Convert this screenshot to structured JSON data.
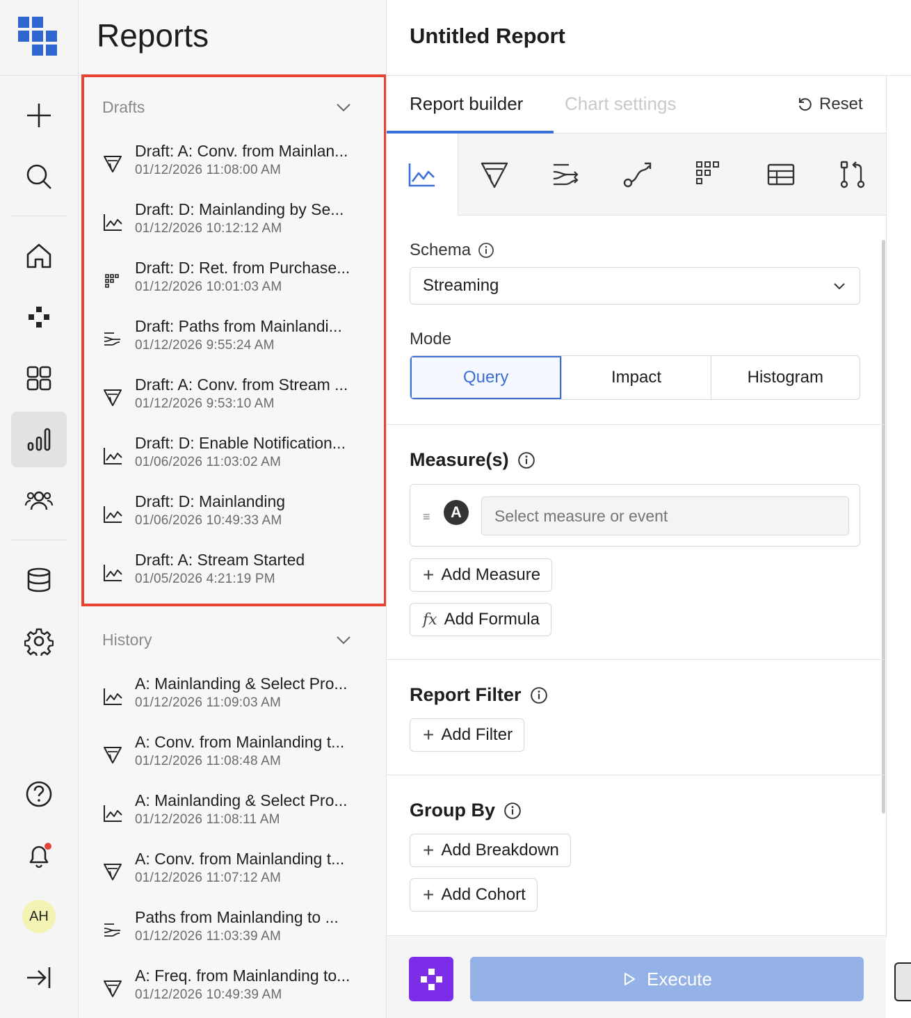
{
  "rail": {
    "logo_icon": "app-grid-logo",
    "items": [
      {
        "name": "add",
        "icon": "plus-icon"
      },
      {
        "name": "search",
        "icon": "search-icon"
      },
      {
        "name": "home",
        "icon": "home-icon"
      },
      {
        "name": "events",
        "icon": "nodes-icon"
      },
      {
        "name": "dashboards",
        "icon": "dashboard-icon"
      },
      {
        "name": "reports",
        "icon": "bar-chart-icon",
        "active": true
      },
      {
        "name": "cohorts",
        "icon": "users-icon"
      },
      {
        "name": "data",
        "icon": "database-icon"
      },
      {
        "name": "settings",
        "icon": "gear-icon"
      },
      {
        "name": "help",
        "icon": "help-icon"
      },
      {
        "name": "notifications",
        "icon": "bell-icon"
      },
      {
        "name": "collapse",
        "icon": "collapse-icon"
      }
    ],
    "avatar_initials": "AH",
    "notification_dot_color": "#e0453a"
  },
  "panel": {
    "title": "Reports",
    "drafts_label": "Drafts",
    "history_label": "History",
    "drafts": [
      {
        "icon": "funnel",
        "title": "Draft: A: Conv. from Mainlan...",
        "date": "01/12/2026 11:08:00 AM"
      },
      {
        "icon": "line",
        "title": "Draft: D: Mainlanding by Se...",
        "date": "01/12/2026 10:12:12 AM"
      },
      {
        "icon": "retention",
        "title": "Draft: D: Ret. from Purchase...",
        "date": "01/12/2026 10:01:03 AM"
      },
      {
        "icon": "paths",
        "title": "Draft: Paths from Mainlandi...",
        "date": "01/12/2026 9:55:24 AM"
      },
      {
        "icon": "funnel",
        "title": "Draft: A: Conv. from Stream ...",
        "date": "01/12/2026 9:53:10 AM"
      },
      {
        "icon": "line",
        "title": "Draft: D: Enable Notification...",
        "date": "01/06/2026 11:03:02 AM"
      },
      {
        "icon": "line",
        "title": "Draft: D: Mainlanding",
        "date": "01/06/2026 10:49:33 AM"
      },
      {
        "icon": "line",
        "title": "Draft: A: Stream Started",
        "date": "01/05/2026 4:21:19 PM"
      }
    ],
    "history": [
      {
        "icon": "line",
        "title": "A: Mainlanding & Select Pro...",
        "date": "01/12/2026 11:09:03 AM"
      },
      {
        "icon": "funnel",
        "title": "A: Conv. from Mainlanding t...",
        "date": "01/12/2026 11:08:48 AM"
      },
      {
        "icon": "line",
        "title": "A: Mainlanding & Select Pro...",
        "date": "01/12/2026 11:08:11 AM"
      },
      {
        "icon": "funnel",
        "title": "A: Conv. from Mainlanding t...",
        "date": "01/12/2026 11:07:12 AM"
      },
      {
        "icon": "paths",
        "title": "Paths from Mainlanding to ...",
        "date": "01/12/2026 11:03:39 AM"
      },
      {
        "icon": "funnel",
        "title": "A: Freq. from Mainlanding to...",
        "date": "01/12/2026 10:49:39 AM"
      }
    ],
    "highlight_color": "#e8432f"
  },
  "main": {
    "title": "Untitled Report",
    "tabs": [
      "Report builder",
      "Chart settings"
    ],
    "active_tab": "Report builder",
    "reset_label": "Reset",
    "report_types": [
      {
        "name": "insights",
        "icon": "line-chart-icon",
        "active": true
      },
      {
        "name": "funnel",
        "icon": "funnel-icon"
      },
      {
        "name": "paths",
        "icon": "paths-icon"
      },
      {
        "name": "flow",
        "icon": "journey-icon"
      },
      {
        "name": "retention",
        "icon": "retention-grid-icon"
      },
      {
        "name": "table",
        "icon": "table-icon"
      },
      {
        "name": "compare",
        "icon": "compare-icon"
      }
    ],
    "schema_label": "Schema",
    "schema_value": "Streaming",
    "mode_label": "Mode",
    "modes": [
      "Query",
      "Impact",
      "Histogram"
    ],
    "active_mode": "Query",
    "measures_label": "Measure(s)",
    "measure_badge": "A",
    "measure_placeholder": "Select measure or event",
    "add_measure": "Add Measure",
    "add_formula": "Add Formula",
    "filter_label": "Report Filter",
    "add_filter": "Add Filter",
    "group_label": "Group By",
    "add_breakdown": "Add Breakdown",
    "add_cohort": "Add Cohort",
    "execute_label": "Execute",
    "accent_color": "#3a6fd8",
    "execute_color": "#94b2e6",
    "brand_button_color": "#7c2de8"
  }
}
